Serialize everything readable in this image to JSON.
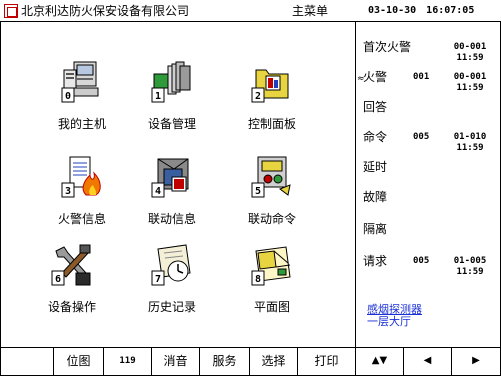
{
  "header": {
    "company": "北京利达防火保安设备有限公司",
    "screen_title": "主菜单",
    "date": "03-10-30",
    "time": "16:07:05"
  },
  "menu": {
    "tiles": [
      {
        "label": "我的主机",
        "icon": "computer-icon"
      },
      {
        "label": "设备管理",
        "icon": "device-icon"
      },
      {
        "label": "控制面板",
        "icon": "control-panel-icon"
      },
      {
        "label": "火警信息",
        "icon": "fire-alarm-icon"
      },
      {
        "label": "联动信息",
        "icon": "linkage-info-icon"
      },
      {
        "label": "联动命令",
        "icon": "linkage-command-icon"
      },
      {
        "label": "设备操作",
        "icon": "tools-icon"
      },
      {
        "label": "历史记录",
        "icon": "history-icon"
      },
      {
        "label": "平面图",
        "icon": "floor-plan-icon"
      }
    ],
    "badges": [
      "0",
      "1",
      "2",
      "3",
      "4",
      "5",
      "6",
      "7",
      "8"
    ]
  },
  "status": {
    "marker": "≈",
    "rows": [
      {
        "label": "首次火警",
        "count": "",
        "addr": "00-001",
        "time": "11:59"
      },
      {
        "label": "火警",
        "count": "001",
        "addr": "00-001",
        "time": "11:59"
      },
      {
        "label": "回答",
        "count": "",
        "addr": "",
        "time": ""
      },
      {
        "label": "命令",
        "count": "005",
        "addr": "01-010",
        "time": "11:59"
      },
      {
        "label": "延时",
        "count": "",
        "addr": "",
        "time": ""
      },
      {
        "label": "故障",
        "count": "",
        "addr": "",
        "time": ""
      },
      {
        "label": "隔离",
        "count": "",
        "addr": "",
        "time": ""
      },
      {
        "label": "请求",
        "count": "005",
        "addr": "01-005",
        "time": "11:59"
      }
    ],
    "info_line1": "感烟探测器",
    "info_line2": "一层大厅",
    "info_color": "#1a2fd6"
  },
  "bottom": {
    "buttons": [
      "位图",
      "119",
      "消音",
      "服务",
      "选择",
      "打印"
    ],
    "nav": [
      "▲▼",
      "◀",
      "▶"
    ]
  },
  "colors": {
    "logo": "#c00000",
    "accent": "#1a2fd6"
  }
}
